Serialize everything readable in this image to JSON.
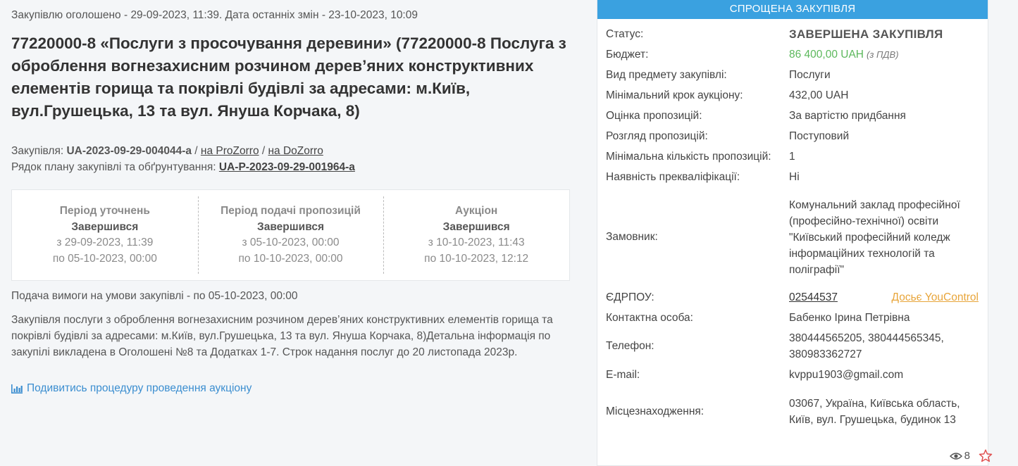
{
  "announce": "Закупівлю оголошено - 29-09-2023, 11:39. Дата останніх змін - 23-10-2023, 10:09",
  "title": "77220000-8 «Послуги з просочування деревини» (77220000-8 Послуга з оброблення вогнезахисним розчином дерев’яних конструктивних елементів горища та покрівлі будівлі за адресами: м.Київ, вул.Грушецька, 13 та вул. Януша Корчака, 8)",
  "ids": {
    "tender_label": "Закупівля:",
    "tender_id": "UA-2023-09-29-004044-a",
    "sep": "/",
    "prozorro": "на ProZorro",
    "dozorro": "на DoZorro",
    "plan_label": "Рядок плану закупівлі та обґрунтування:",
    "plan_id": "UA-P-2023-09-29-001964-a"
  },
  "periods": [
    {
      "name": "Період уточнень",
      "status": "Завершився",
      "from": "з 29-09-2023, 11:39",
      "to": "по 05-10-2023, 00:00"
    },
    {
      "name": "Період подачі пропозицій",
      "status": "Завершився",
      "from": "з 05-10-2023, 00:00",
      "to": "по 10-10-2023, 00:00"
    },
    {
      "name": "Аукціон",
      "status": "Завершився",
      "from": "з 10-10-2023, 11:43",
      "to": "по 10-10-2023, 12:12"
    }
  ],
  "claim": "Подача вимоги на умови закупівлі - по 05-10-2023, 00:00",
  "description": "Закупівля послуги з оброблення вогнезахисним розчином дерев’яних конструктивних елементів горища та покрівлі будівлі за адресами: м.Київ, вул.Грушецька, 13 та вул. Януша Корчака, 8)Детальна інформація по закупілі викладена в Оголошені №8 та Додатках 1-7. Строк надання послуг до 20 листопада 2023р.",
  "auction_link": "Подивитись процедуру проведення аукціону",
  "panel": {
    "header": "СПРОЩЕНА ЗАКУПІВЛЯ",
    "status_label": "Статус:",
    "status": "ЗАВЕРШЕНА ЗАКУПІВЛЯ",
    "budget_label": "Бюджет:",
    "budget": "86 400,00 UAH",
    "budget_vat": "(з ПДВ)",
    "subject_label": "Вид предмету закупівлі:",
    "subject": "Послуги",
    "step_label": "Мінімальний крок аукціону:",
    "step": "432,00 UAH",
    "eval_label": "Оцінка пропозицій:",
    "eval": "За вартістю придбання",
    "review_label": "Розгляд пропозицій:",
    "review": "Поступовий",
    "min_bids_label": "Мінімальна кількість пропозицій:",
    "min_bids": "1",
    "prequal_label": "Наявність прекваліфікації:",
    "prequal": "Ні",
    "customer_label": "Замовник:",
    "customer": "Комунальний заклад професійної (професійно-технічної) освіти \"Київський професійний коледж інформаційних технологій та поліграфії\"",
    "edrpou_label": "ЄДРПОУ:",
    "edrpou": "02544537",
    "dossier": "Досьє YouControl",
    "contact_label": "Контактна особа:",
    "contact": "Бабенко Ірина Петрівна",
    "phone_label": "Телефон:",
    "phone": "380444565205, 380444565345, 380983362727",
    "email_label": "E-mail:",
    "email": "kvppu1903@gmail.com",
    "location_label": "Місцезнаходження:",
    "location": "03067, Україна, Київська область, Київ, вул. Грушецька, будинок 13",
    "views": "8"
  },
  "colors": {
    "accent": "#3aa1e0",
    "budget": "#5cb85c",
    "link": "#3b8ed0",
    "youcontrol": "#e8a53a",
    "star": "#e05050"
  },
  "icons": [
    "bar-chart-icon",
    "eye-icon",
    "star-icon"
  ]
}
